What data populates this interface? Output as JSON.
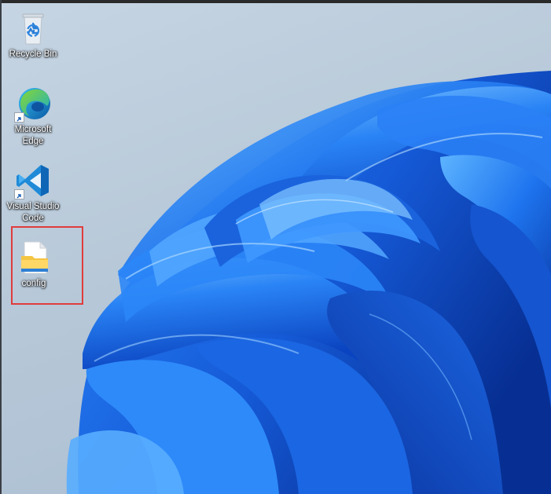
{
  "desktop": {
    "icons": [
      {
        "label": "Recycle Bin",
        "icon": "recycle-bin-icon"
      },
      {
        "label": "Microsoft\nEdge",
        "icon": "microsoft-edge-icon",
        "shortcut": true
      },
      {
        "label": "Visual Studio\nCode",
        "icon": "vscode-icon",
        "shortcut": true
      },
      {
        "label": "config",
        "icon": "text-file-icon",
        "highlighted": true
      }
    ],
    "highlight_color": "#e03c3c",
    "wallpaper": "windows-11-bloom"
  },
  "colors": {
    "bloom_dark": "#0a3fb5",
    "bloom_mid": "#1f6fe8",
    "bloom_light": "#4aa3ff",
    "background": "#b7c8d8"
  }
}
